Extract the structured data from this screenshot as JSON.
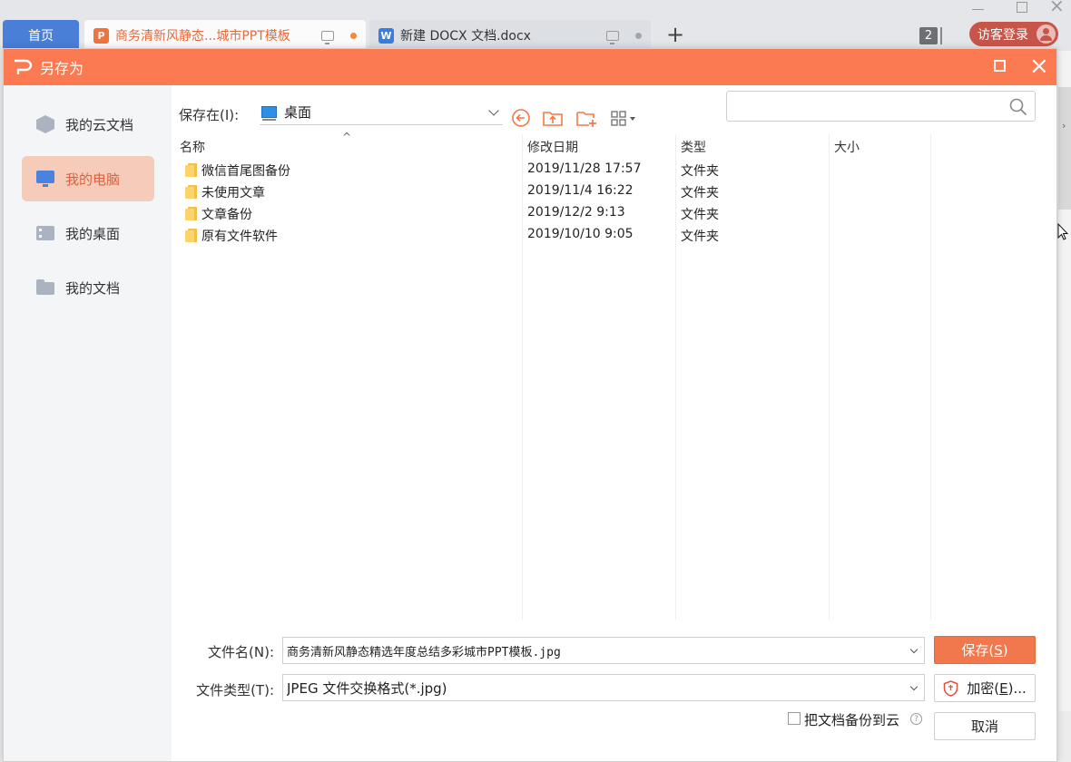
{
  "tabs": {
    "home_label": "首页",
    "ppt_title": "商务清新风静态...城市PPT模板",
    "docx_title": "新建 DOCX 文档.docx",
    "tab_count": "2",
    "login_label": "访客登录"
  },
  "dialog": {
    "title": "另存为",
    "sidebar": [
      {
        "label": "我的云文档",
        "icon": "cloud-cube-icon",
        "active": false
      },
      {
        "label": "我的电脑",
        "icon": "computer-icon",
        "active": true
      },
      {
        "label": "我的桌面",
        "icon": "desktop-icon",
        "active": false
      },
      {
        "label": "我的文档",
        "icon": "folder-icon",
        "active": false
      }
    ],
    "save_in_label": "保存在(I):",
    "save_in_value": "桌面",
    "search_placeholder": "",
    "columns": {
      "name": "名称",
      "date": "修改日期",
      "type": "类型",
      "size": "大小"
    },
    "files": [
      {
        "name": "微信首尾图备份",
        "date": "2019/11/28 17:57",
        "type": "文件夹",
        "size": ""
      },
      {
        "name": "未使用文章",
        "date": "2019/11/4 16:22",
        "type": "文件夹",
        "size": ""
      },
      {
        "name": "文章备份",
        "date": "2019/12/2 9:13",
        "type": "文件夹",
        "size": ""
      },
      {
        "name": "原有文件软件",
        "date": "2019/10/10 9:05",
        "type": "文件夹",
        "size": ""
      }
    ],
    "filename_label": "文件名(N):",
    "filename_value": "商务清新风静态精选年度总结多彩城市PPT模板.jpg",
    "filetype_label": "文件类型(T):",
    "filetype_value": "JPEG 文件交换格式(*.jpg)",
    "save_button": "保存(",
    "save_key": "S",
    "encrypt_button": "加密(",
    "encrypt_key": "E",
    "encrypt_suffix": ")...",
    "cancel_button": "取消",
    "backup_label": "把文档备份到云",
    "backup_checked": false
  },
  "colors": {
    "accent": "#fb7a52",
    "active_bg": "#f5cbb9",
    "home_tab": "#4a7fd8",
    "login": "#c7554a"
  }
}
